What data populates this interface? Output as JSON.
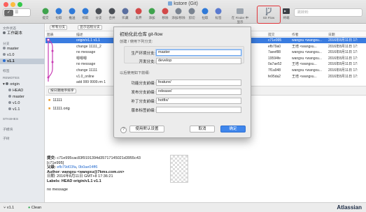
{
  "window": {
    "title": "kstore (Git)"
  },
  "view_mode": "✓",
  "toolbar": {
    "items": [
      {
        "label": "提交",
        "icon": "commit-icon"
      },
      {
        "label": "拉取",
        "icon": "pull-icon"
      },
      {
        "label": "推送",
        "icon": "push-icon"
      },
      {
        "label": "抓取",
        "icon": "fetch-icon"
      },
      {
        "label": "分支",
        "icon": "branch-icon"
      },
      {
        "label": "合并",
        "icon": "merge-icon"
      },
      {
        "label": "贮藏",
        "icon": "stash-icon"
      },
      {
        "label": "丢弃",
        "icon": "discard-icon"
      },
      {
        "label": "添加",
        "icon": "add-icon"
      },
      {
        "label": "移除",
        "icon": "remove-icon"
      },
      {
        "label": "添加/移除",
        "icon": "add-remove-icon"
      },
      {
        "label": "剪切",
        "icon": "cut-icon"
      },
      {
        "label": "拉取",
        "icon": "pull-icon"
      },
      {
        "label": "标签",
        "icon": "tag-icon"
      }
    ],
    "finder_label": "在 Finder 中显示",
    "flow_label": "Git Flow",
    "terminal_label": "终端",
    "settings_label": "设置",
    "jump_label": "跳转到:"
  },
  "sidebar": {
    "header_workspace": "文件状态",
    "workspace_item": "工作副本",
    "header_branches": "分支",
    "branches": [
      "master",
      "v1.0",
      "v1.1"
    ],
    "header_tags": "标签",
    "header_remotes": "REMOTES",
    "remote_name": "origin",
    "remote_branches": [
      "HEAD",
      "master",
      "v1.0",
      "v1.1"
    ],
    "header_stashes": "STASHES",
    "header_submodules": "子模块",
    "header_subtrees": "子树"
  },
  "filter": {
    "branch": "所有分支",
    "mode": "显示远程分支",
    "order": "按日期顺序排序"
  },
  "columns": {
    "graph": "图表",
    "description": "描述",
    "commit": "提交",
    "author": "作者",
    "date": "日期"
  },
  "commits": [
    {
      "desc": "origin/v1.1 v1.1",
      "hash": "c71e995",
      "author": "wangxu <wangxu...",
      "date": "2016年8月11日 17:",
      "selected": true
    },
    {
      "desc": "change 11111_2",
      "hash": "efb79a0",
      "author": "王培 <wangxu...",
      "date": "2016年8月11日 17:"
    },
    {
      "desc": "no message",
      "hash": "7aeef88",
      "author": "wangxu <wangxu...",
      "date": "2016年8月11日 17:"
    },
    {
      "desc": "嗯嗯嗯",
      "hash": "19594fe",
      "author": "wangxu <wangxu...",
      "date": "2016年8月11日 17:"
    },
    {
      "desc": "no message",
      "hash": "0a7ae52",
      "author": "王培 <wangxu...",
      "date": "2016年8月11日 17:"
    },
    {
      "desc": "change 11111",
      "hash": "7f1a948",
      "author": "wangxu <wangxu...",
      "date": "2016年8月11日 17:"
    },
    {
      "desc": "v1.0_online",
      "hash": "fe95da2",
      "author": "王培 <wangxu...",
      "date": "2016年8月11日 17:"
    },
    {
      "desc": "add 999 9999.rm 1",
      "hash": "",
      "author": "",
      "date": ""
    }
  ],
  "files": [
    "11111",
    "11111.orig"
  ],
  "commit_detail": {
    "commit_label": "提交:",
    "commit_hash": "c71e995cac83f9191394d35717145021d3955c43",
    "short": "[c71e995]",
    "parent_label": "父级:",
    "parent1": "efb79d03fa",
    "parent2": "0b0ae04ff6",
    "author_line": "Author: wangxu <wangxu@7kms.com.cn>",
    "date_line": "日期:   2016年8月11日 GMT+8 17:36:21",
    "labels_line": "Labels: HEAD origin/v1.1 v1.1",
    "message": "no message"
  },
  "status": {
    "branch": "v1.1",
    "state": "Clean",
    "brand": "Atlassian"
  },
  "dialog": {
    "title": "初始化此仓库 git-flow",
    "section1": "创建 / 使用下列分支:",
    "production_label": "生产环境分支:",
    "production_value": "master",
    "develop_label": "开发分支:",
    "develop_value": "develop",
    "section2": "以后使用如下前缀:",
    "feature_label": "功能分支前缀:",
    "feature_value": "feature/",
    "release_label": "发布分支前缀:",
    "release_value": "release/",
    "hotfix_label": "补丁分支前缀:",
    "hotfix_value": "hotfix/",
    "version_label": "版本标签前缀:",
    "version_value": "",
    "help": "?",
    "defaults_button": "使用默认设置",
    "cancel_button": "取消",
    "ok_button": "确定"
  }
}
